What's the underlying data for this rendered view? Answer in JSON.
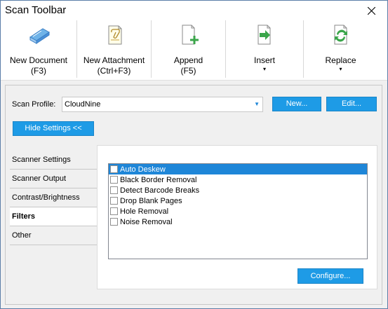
{
  "window": {
    "title": "Scan Toolbar",
    "close_icon": "close-icon"
  },
  "toolbar": {
    "buttons": [
      {
        "line1": "New Document",
        "line2": "(F3)",
        "icon": "scanner-icon"
      },
      {
        "line1": "New Attachment",
        "line2": "(Ctrl+F3)",
        "icon": "attachment-page-icon"
      },
      {
        "line1": "Append",
        "line2": "(F5)",
        "icon": "append-page-icon"
      },
      {
        "line1": "Insert",
        "line2": "▾",
        "icon": "insert-page-icon"
      },
      {
        "line1": "Replace",
        "line2": "▾",
        "icon": "replace-page-icon"
      }
    ]
  },
  "profile": {
    "label": "Scan Profile:",
    "value": "CloudNine",
    "new_label": "New...",
    "edit_label": "Edit..."
  },
  "settings": {
    "toggle_label": "Hide Settings <<"
  },
  "tabs": [
    {
      "label": "Scanner Settings"
    },
    {
      "label": "Scanner Output"
    },
    {
      "label": "Contrast/Brightness"
    },
    {
      "label": "Filters"
    },
    {
      "label": "Other"
    }
  ],
  "filters": {
    "items": [
      {
        "label": "Auto Deskew",
        "checked": false
      },
      {
        "label": "Black Border Removal",
        "checked": false
      },
      {
        "label": "Detect Barcode Breaks",
        "checked": false
      },
      {
        "label": "Drop Blank Pages",
        "checked": false
      },
      {
        "label": "Hole Removal",
        "checked": false
      },
      {
        "label": "Noise Removal",
        "checked": false
      }
    ],
    "selected_label": "Auto Deskew",
    "configure_label": "Configure..."
  },
  "colors": {
    "accent": "#1e9be6",
    "selection": "#1e86d8"
  }
}
